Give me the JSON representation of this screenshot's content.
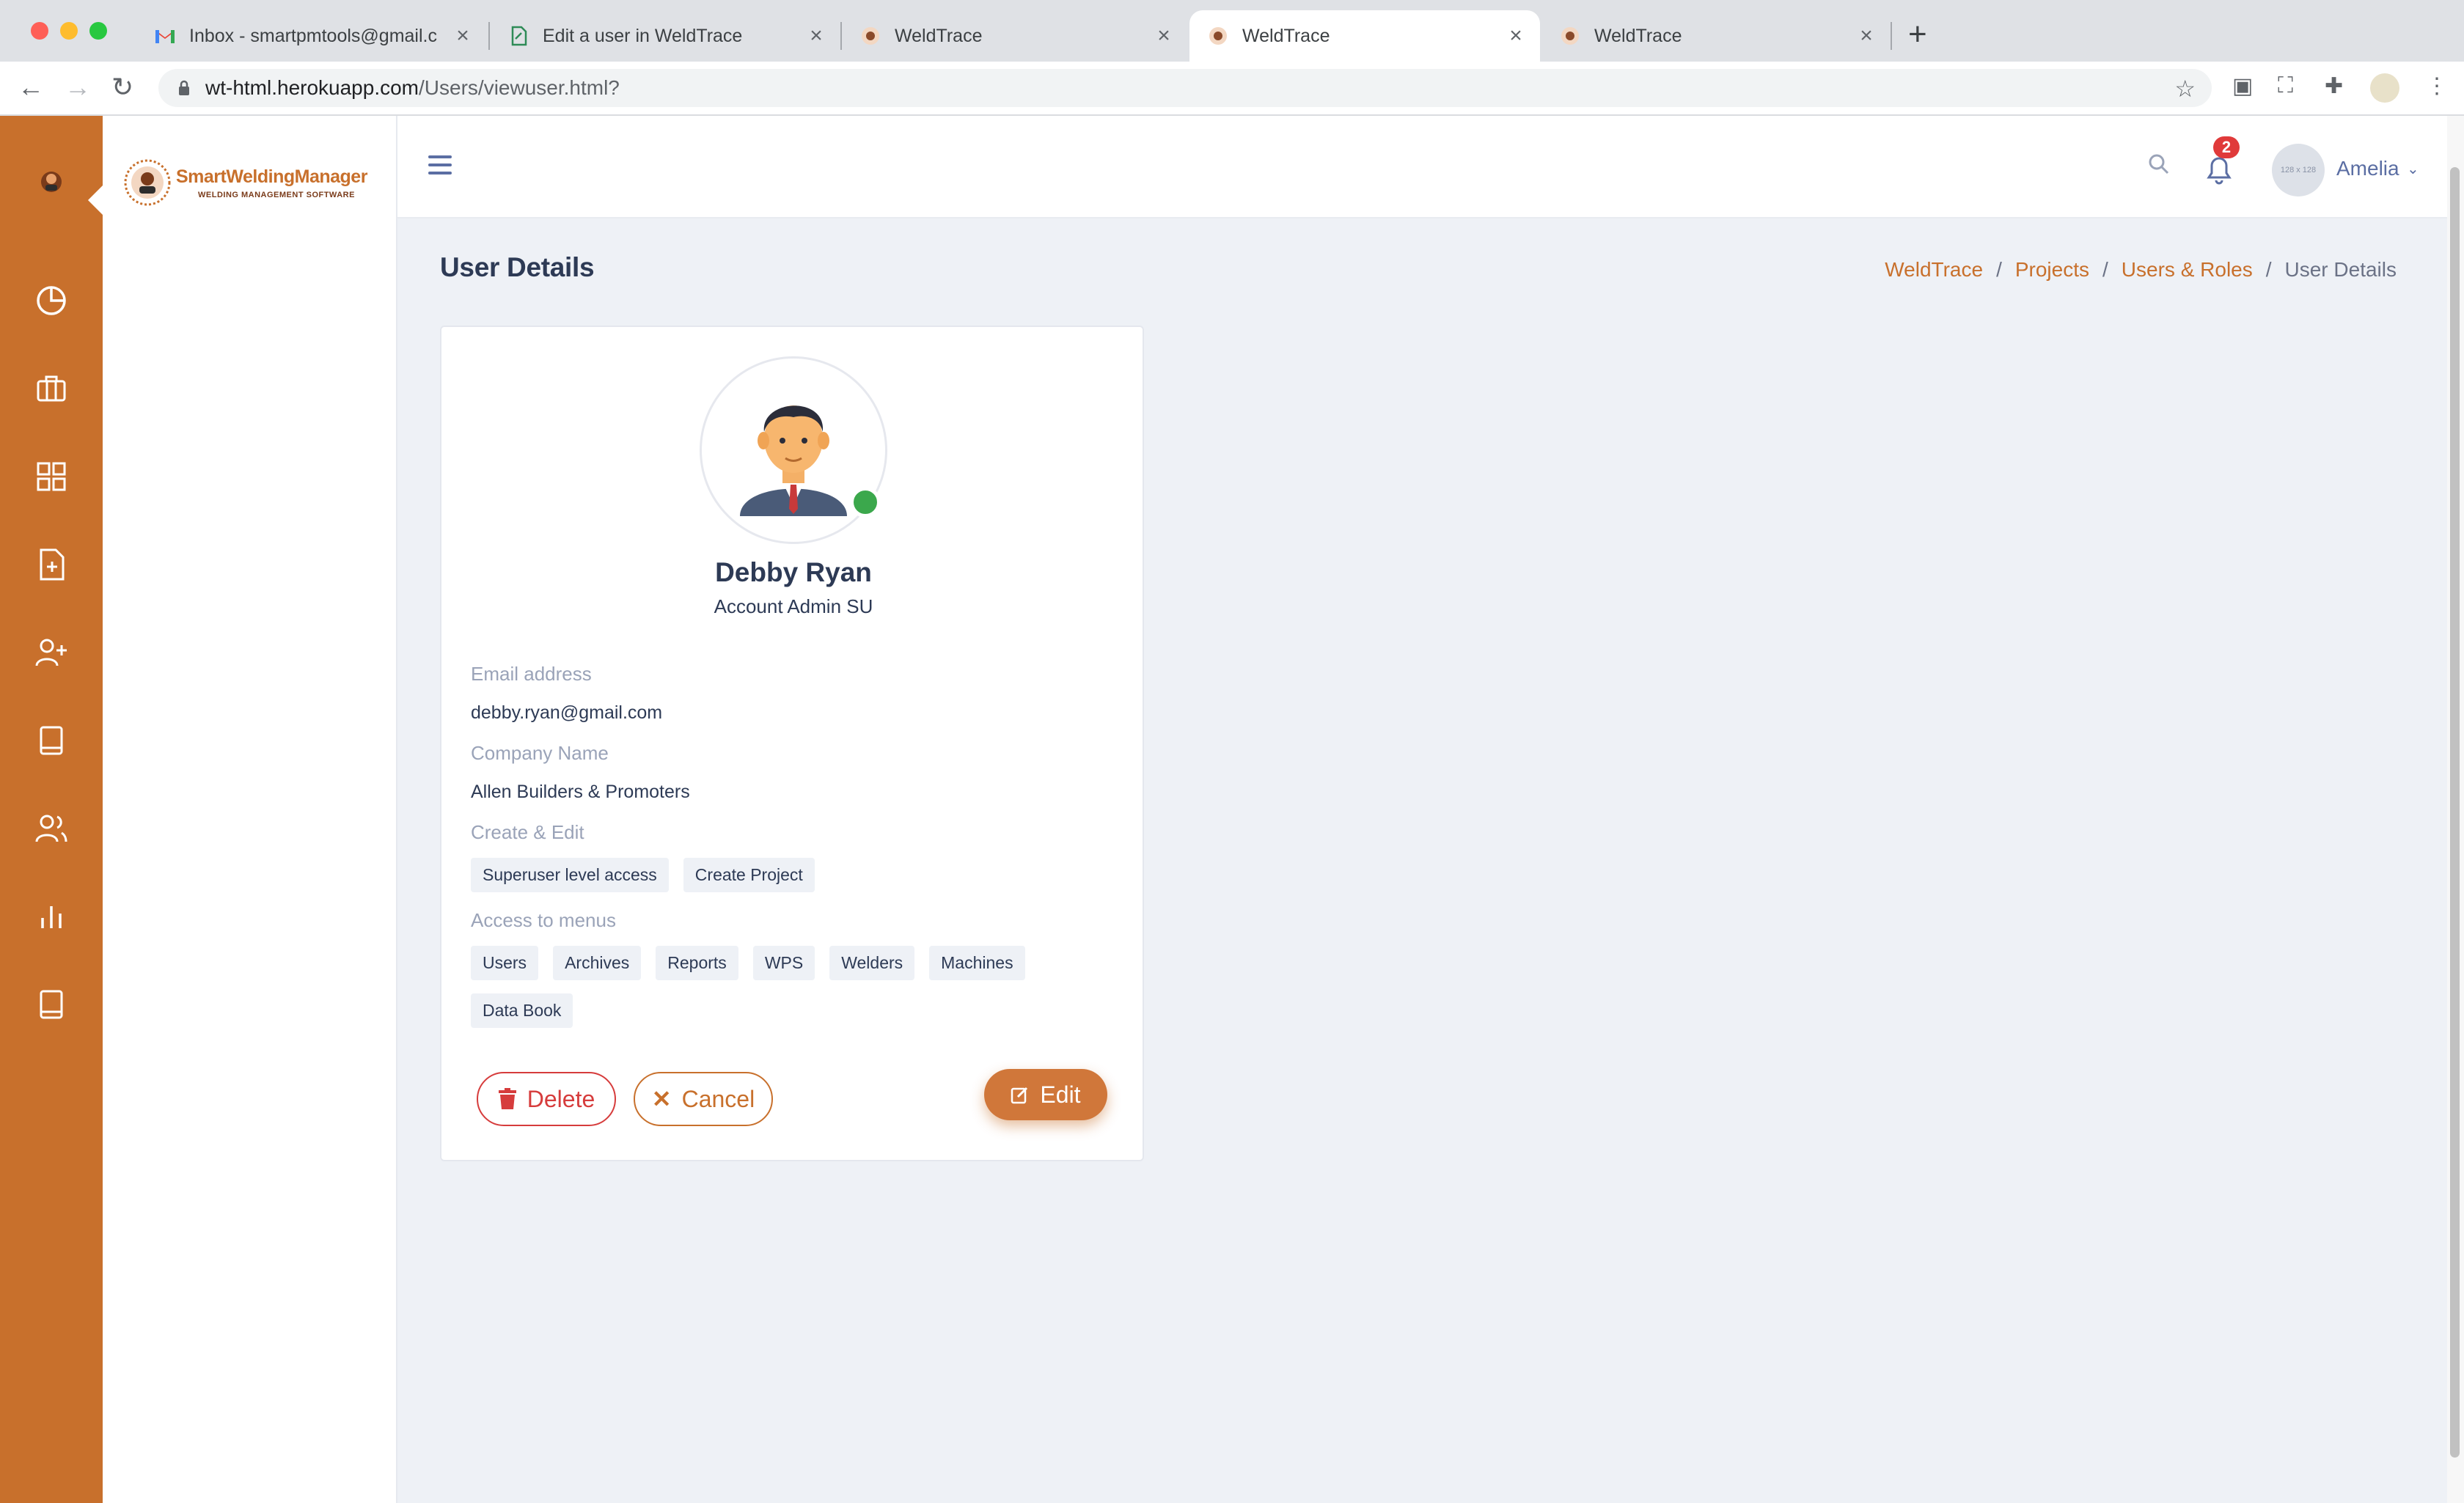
{
  "browser": {
    "tabs": [
      {
        "title": "Inbox - smartpmtools@gmail.c",
        "icon": "gmail-icon"
      },
      {
        "title": "Edit a user in WeldTrace",
        "icon": "page-icon"
      },
      {
        "title": "WeldTrace",
        "icon": "weldtrace-icon"
      },
      {
        "title": "WeldTrace",
        "icon": "weldtrace-icon"
      },
      {
        "title": "WeldTrace",
        "icon": "weldtrace-icon"
      }
    ],
    "active_tab_index": 3,
    "url_host": "wt-html.herokuapp.com",
    "url_path": "/Users/viewuser.html?"
  },
  "brand": {
    "name": "SmartWeldingManager",
    "tagline": "WELDING MANAGEMENT SOFTWARE",
    "accent": "#c8702c"
  },
  "sidebar": {
    "items": [
      {
        "icon": "dashboard-icon"
      },
      {
        "icon": "briefcase-icon"
      },
      {
        "icon": "grid-icon"
      },
      {
        "icon": "file-add-icon"
      },
      {
        "icon": "user-add-icon"
      },
      {
        "icon": "book-icon"
      },
      {
        "icon": "users-icon"
      },
      {
        "icon": "bar-chart-icon"
      },
      {
        "icon": "book-icon"
      }
    ],
    "active_index": 0
  },
  "header": {
    "notification_count": "2",
    "avatar_placeholder": "128 x 128",
    "user_name": "Amelia"
  },
  "page": {
    "title": "User Details",
    "breadcrumb": [
      "WeldTrace",
      "Projects",
      "Users & Roles",
      "User Details"
    ]
  },
  "user": {
    "name": "Debby Ryan",
    "role": "Account Admin SU",
    "status_color": "#3ba84c",
    "email_label": "Email address",
    "email": "debby.ryan@gmail.com",
    "company_label": "Company Name",
    "company": "Allen Builders & Promoters",
    "create_edit_label": "Create & Edit",
    "create_edit": [
      "Superuser level access",
      "Create Project"
    ],
    "menus_label": "Access to menus",
    "menus": [
      "Users",
      "Archives",
      "Reports",
      "WPS",
      "Welders",
      "Machines",
      "Data Book"
    ]
  },
  "actions": {
    "delete": "Delete",
    "cancel": "Cancel",
    "edit": "Edit"
  }
}
